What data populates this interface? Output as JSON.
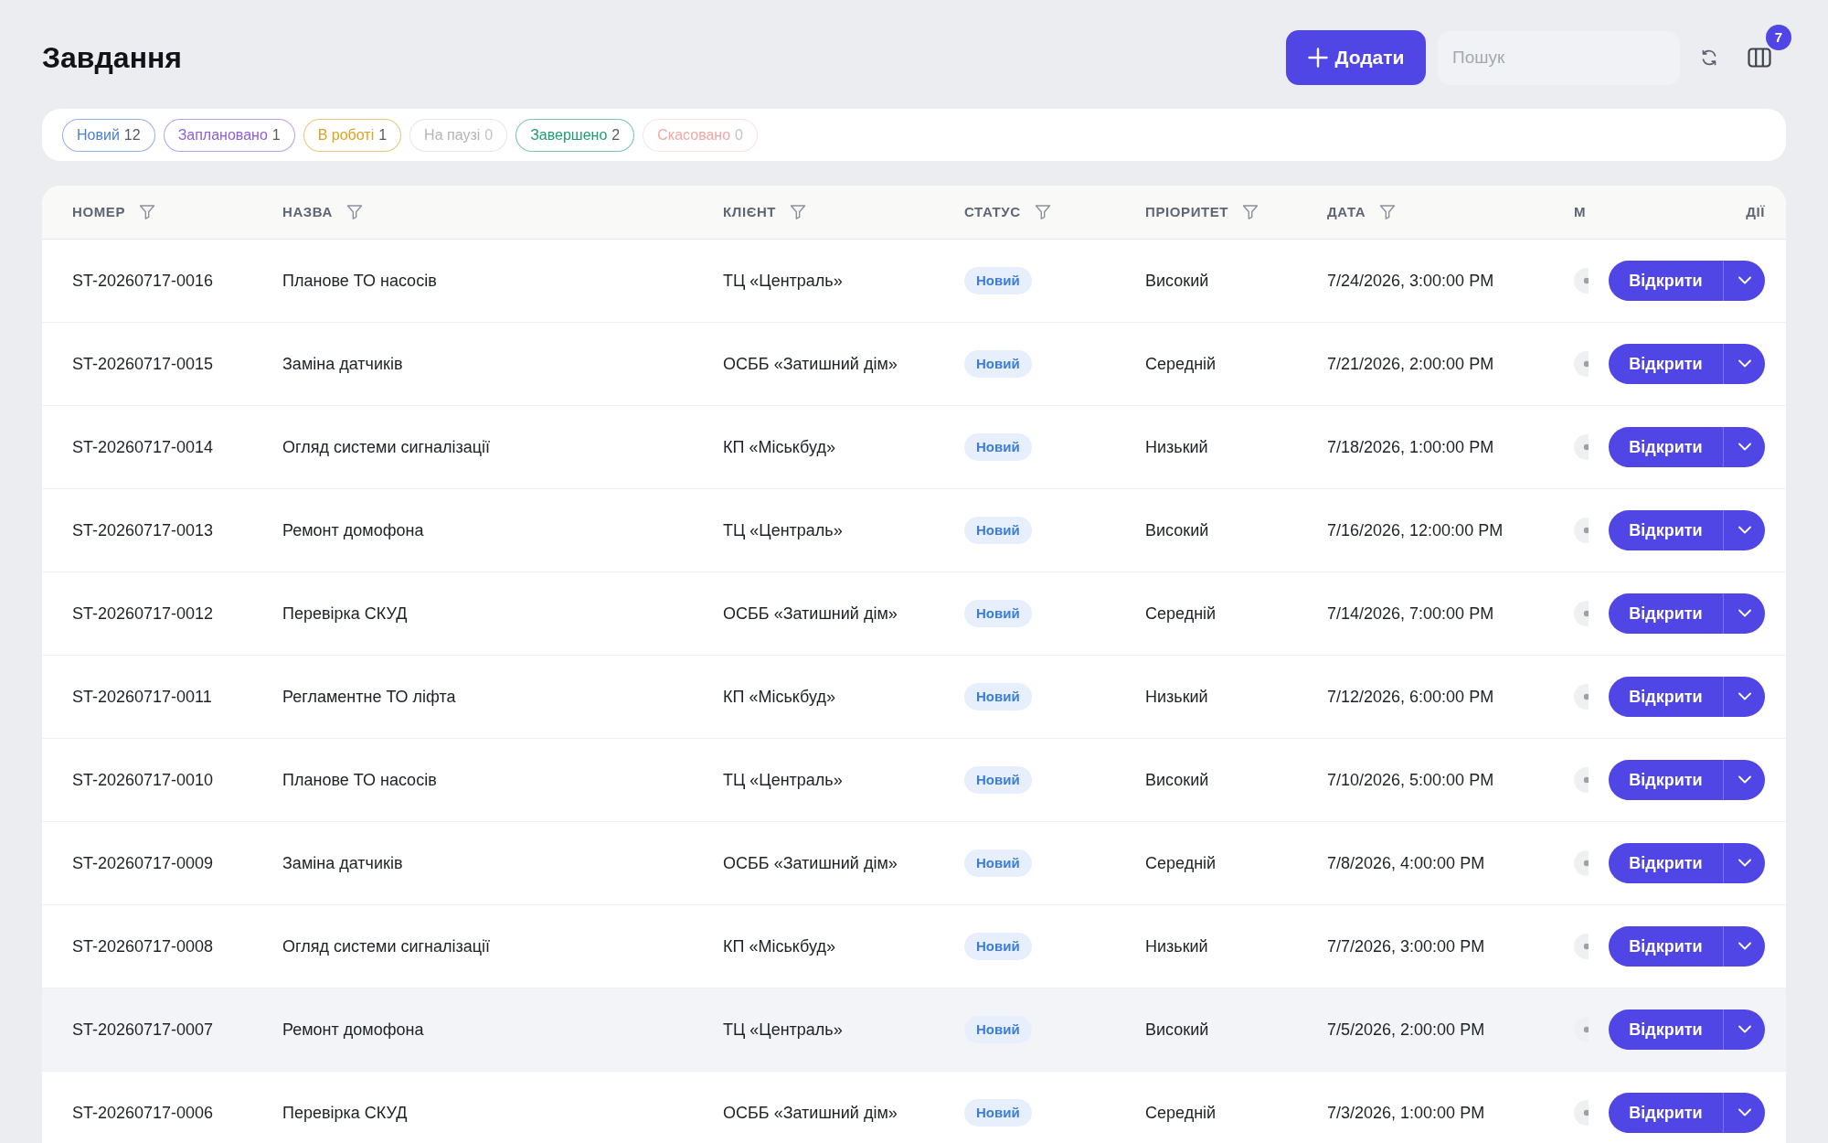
{
  "page": {
    "title": "Завдання"
  },
  "toolbar": {
    "add_button": {
      "label": "Додати"
    },
    "search": {
      "placeholder": "Пошук"
    },
    "columns_badge": "7"
  },
  "status_filters": [
    {
      "label": "Новий",
      "count": "12",
      "color": "#4a7fd6",
      "disabled": false
    },
    {
      "label": "Заплановано",
      "count": "1",
      "color": "#8e5ee0",
      "disabled": false
    },
    {
      "label": "В роботі",
      "count": "1",
      "color": "#e0a020",
      "disabled": false
    },
    {
      "label": "На паузі",
      "count": "0",
      "color": "#b4b4b4",
      "disabled": true
    },
    {
      "label": "Завершено",
      "count": "2",
      "color": "#1e9e6e",
      "disabled": false
    },
    {
      "label": "Скасовано",
      "count": "0",
      "color": "#f2a7a7",
      "disabled": true
    }
  ],
  "table": {
    "columns": [
      {
        "label": "НОМЕР",
        "filter": true
      },
      {
        "label": "НАЗВА",
        "filter": true
      },
      {
        "label": "КЛІЄНТ",
        "filter": true
      },
      {
        "label": "СТАТУС",
        "filter": true
      },
      {
        "label": "ПРІОРИТЕТ",
        "filter": true
      },
      {
        "label": "ДАТА",
        "filter": true
      },
      {
        "label": "М",
        "filter": false
      },
      {
        "label": "ДІЇ",
        "filter": false
      }
    ],
    "rows": [
      {
        "number": "ST-20260717-0016",
        "name": "Планове ТО насосів",
        "client": "ТЦ «Централь»",
        "status": "Новий",
        "priority": "Високий",
        "date": "7/24/2026, 3:00:00 PM",
        "action": "Відкрити",
        "highlighted": false
      },
      {
        "number": "ST-20260717-0015",
        "name": "Заміна датчиків",
        "client": "ОСББ «Затишний дім»",
        "status": "Новий",
        "priority": "Середній",
        "date": "7/21/2026, 2:00:00 PM",
        "action": "Відкрити",
        "highlighted": false
      },
      {
        "number": "ST-20260717-0014",
        "name": "Огляд системи сигналізації",
        "client": "КП «Міськбуд»",
        "status": "Новий",
        "priority": "Низький",
        "date": "7/18/2026, 1:00:00 PM",
        "action": "Відкрити",
        "highlighted": false
      },
      {
        "number": "ST-20260717-0013",
        "name": "Ремонт домофона",
        "client": "ТЦ «Централь»",
        "status": "Новий",
        "priority": "Високий",
        "date": "7/16/2026, 12:00:00 PM",
        "action": "Відкрити",
        "highlighted": false
      },
      {
        "number": "ST-20260717-0012",
        "name": "Перевірка СКУД",
        "client": "ОСББ «Затишний дім»",
        "status": "Новий",
        "priority": "Середній",
        "date": "7/14/2026, 7:00:00 PM",
        "action": "Відкрити",
        "highlighted": false
      },
      {
        "number": "ST-20260717-0011",
        "name": "Регламентне ТО ліфта",
        "client": "КП «Міськбуд»",
        "status": "Новий",
        "priority": "Низький",
        "date": "7/12/2026, 6:00:00 PM",
        "action": "Відкрити",
        "highlighted": false
      },
      {
        "number": "ST-20260717-0010",
        "name": "Планове ТО насосів",
        "client": "ТЦ «Централь»",
        "status": "Новий",
        "priority": "Високий",
        "date": "7/10/2026, 5:00:00 PM",
        "action": "Відкрити",
        "highlighted": false
      },
      {
        "number": "ST-20260717-0009",
        "name": "Заміна датчиків",
        "client": "ОСББ «Затишний дім»",
        "status": "Новий",
        "priority": "Середній",
        "date": "7/8/2026, 4:00:00 PM",
        "action": "Відкрити",
        "highlighted": false
      },
      {
        "number": "ST-20260717-0008",
        "name": "Огляд системи сигналізації",
        "client": "КП «Міськбуд»",
        "status": "Новий",
        "priority": "Низький",
        "date": "7/7/2026, 3:00:00 PM",
        "action": "Відкрити",
        "highlighted": false
      },
      {
        "number": "ST-20260717-0007",
        "name": "Ремонт домофона",
        "client": "ТЦ «Централь»",
        "status": "Новий",
        "priority": "Високий",
        "date": "7/5/2026, 2:00:00 PM",
        "action": "Відкрити",
        "highlighted": true
      },
      {
        "number": "ST-20260717-0006",
        "name": "Перевірка СКУД",
        "client": "ОСББ «Затишний дім»",
        "status": "Новий",
        "priority": "Середній",
        "date": "7/3/2026, 1:00:00 PM",
        "action": "Відкрити",
        "highlighted": false
      }
    ]
  }
}
